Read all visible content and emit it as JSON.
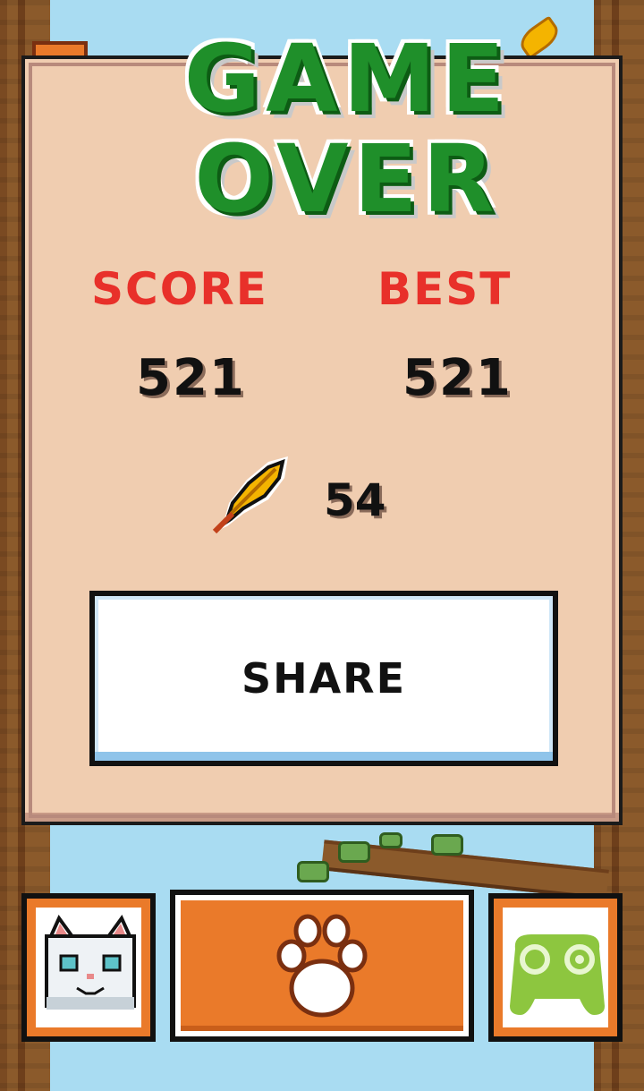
{
  "title": {
    "line1": "GAME",
    "line2": "OVER"
  },
  "score": {
    "label": "SCORE",
    "value": "521"
  },
  "best": {
    "label": "BEST",
    "value": "521"
  },
  "feathers": {
    "count": "54",
    "icon": "feather-icon"
  },
  "share_button": {
    "label": "SHARE"
  },
  "bottom_bar": {
    "left_icon": "cat-face-icon",
    "center_icon": "paw-icon",
    "right_icon": "game-controller-icon"
  },
  "colors": {
    "title_green": "#1f8f2a",
    "label_red": "#e8302a",
    "button_orange": "#ea7a2a",
    "panel_beige": "#f0cdb0",
    "sky_blue": "#a9dcf2"
  }
}
